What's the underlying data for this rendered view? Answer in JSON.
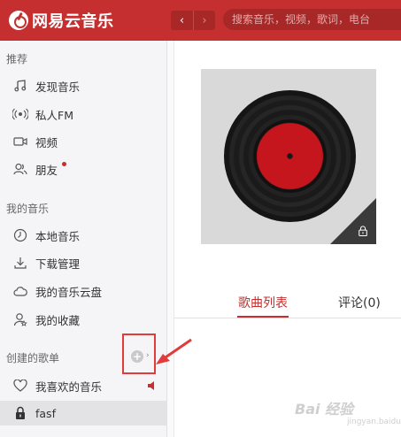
{
  "app": {
    "title": "网易云音乐"
  },
  "search": {
    "placeholder": "搜索音乐，视频，歌词，电台"
  },
  "sidebar": {
    "sections": [
      {
        "title": "推荐",
        "items": [
          {
            "label": "发现音乐",
            "icon": "music-note-icon"
          },
          {
            "label": "私人FM",
            "icon": "radio-icon"
          },
          {
            "label": "视频",
            "icon": "video-icon"
          },
          {
            "label": "朋友",
            "icon": "friends-icon",
            "badge": "red-dot"
          }
        ]
      },
      {
        "title": "我的音乐",
        "items": [
          {
            "label": "本地音乐",
            "icon": "clock-icon"
          },
          {
            "label": "下载管理",
            "icon": "download-icon"
          },
          {
            "label": "我的音乐云盘",
            "icon": "cloud-icon"
          },
          {
            "label": "我的收藏",
            "icon": "collect-icon"
          }
        ]
      },
      {
        "title": "创建的歌单",
        "items": [
          {
            "label": "我喜欢的音乐",
            "icon": "heart-icon",
            "playing": true
          },
          {
            "label": "fasf",
            "icon": "lock-icon",
            "active": true
          }
        ]
      }
    ]
  },
  "nav": {
    "back": "‹",
    "forward": "›"
  },
  "main": {
    "tabs": [
      {
        "label": "歌曲列表",
        "active": true
      },
      {
        "label": "评论(0)",
        "active": false
      }
    ]
  },
  "watermark": {
    "text": "Bai 经验",
    "sub": "jingyan.baidu.com"
  },
  "colors": {
    "accent": "#c62f2f",
    "annotation": "#e13b3b"
  }
}
